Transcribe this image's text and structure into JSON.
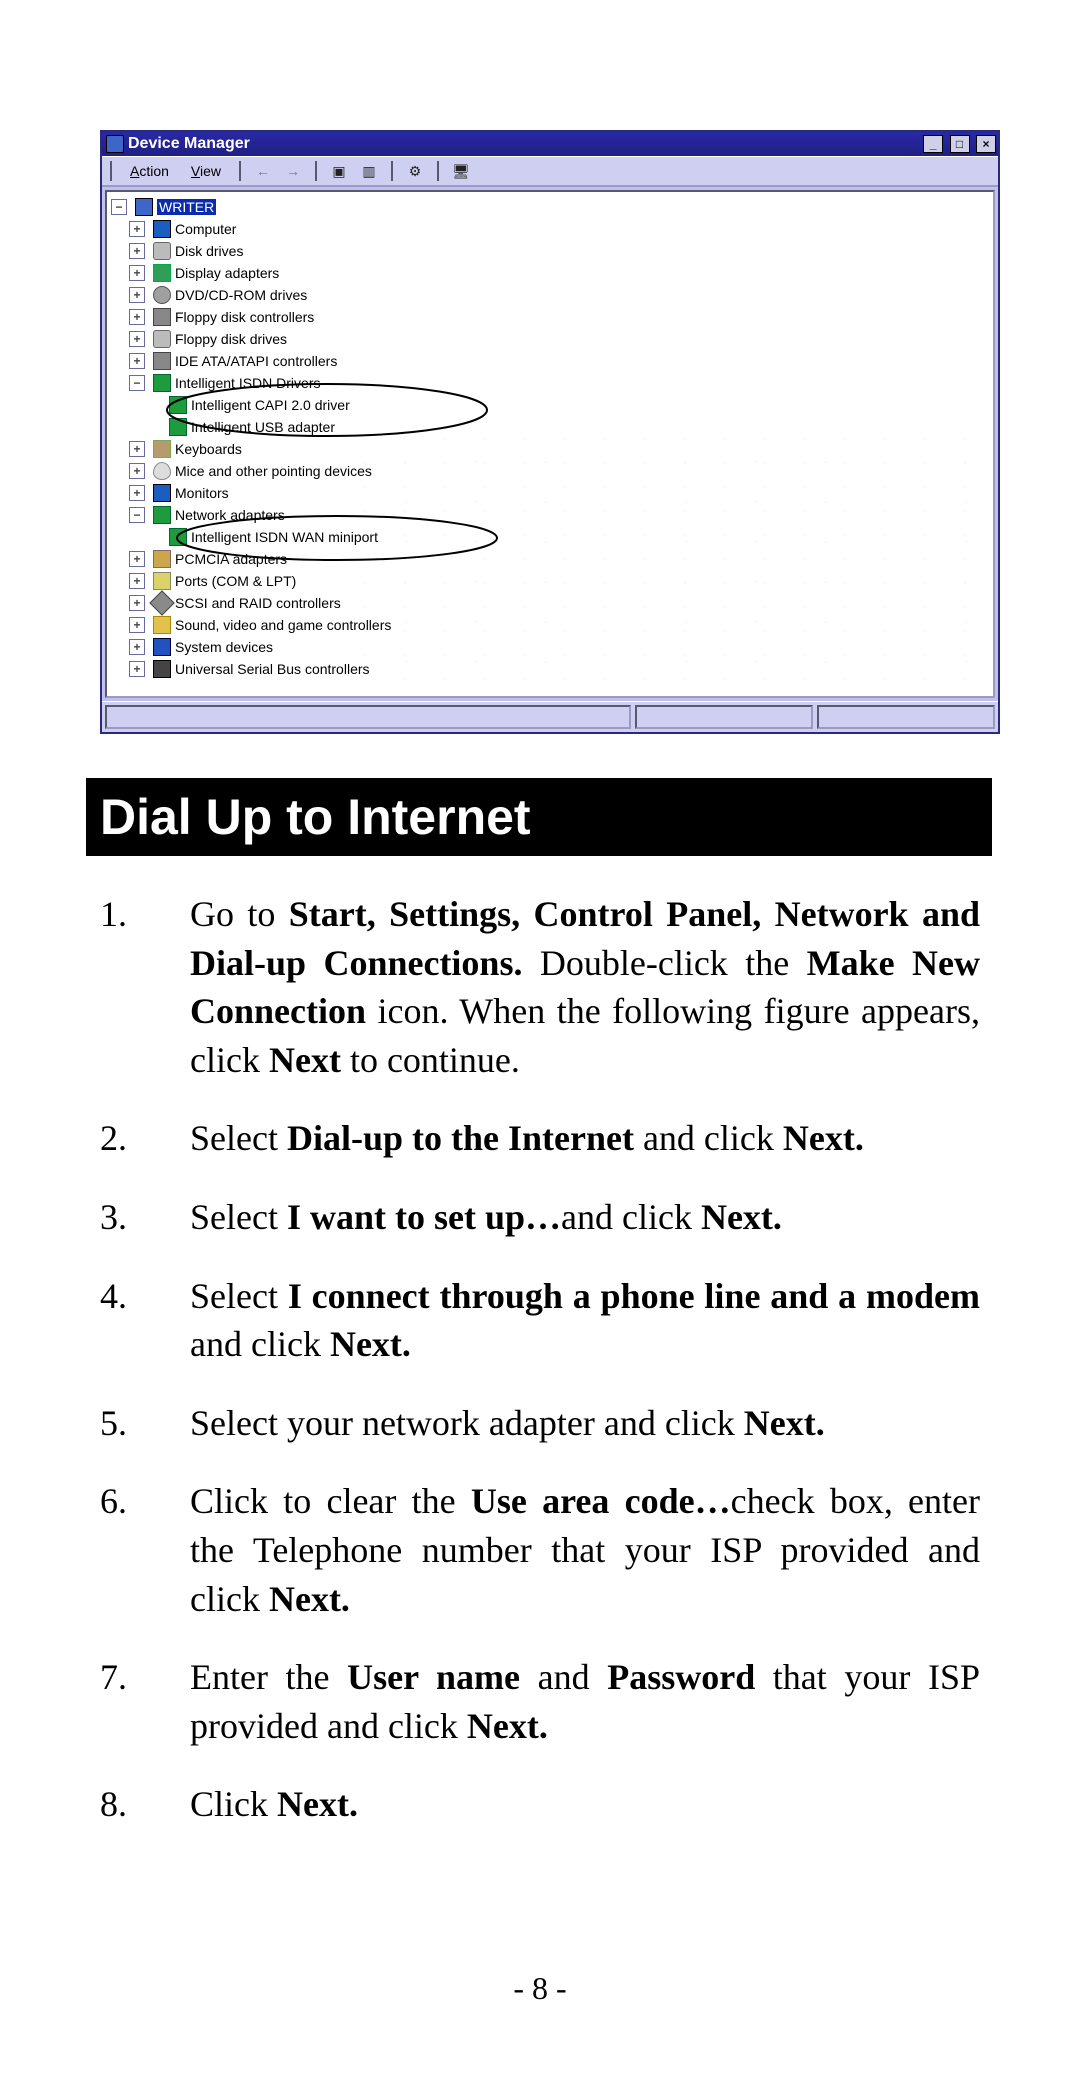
{
  "device_manager": {
    "title": "Device Manager",
    "menus": {
      "action": "Action",
      "view": "View"
    },
    "root": "WRITER",
    "nodes": {
      "computer": "Computer",
      "disk_drives": "Disk drives",
      "display": "Display adapters",
      "dvd": "DVD/CD-ROM drives",
      "floppy_ctrl": "Floppy disk controllers",
      "floppy_drv": "Floppy disk drives",
      "ide": "IDE ATA/ATAPI controllers",
      "isdn": "Intelligent ISDN Drivers",
      "isdn_capi": "Intelligent CAPI 2.0 driver",
      "isdn_usb": "Intelligent USB adapter",
      "keyboards": "Keyboards",
      "mice": "Mice and other pointing devices",
      "monitors": "Monitors",
      "net": "Network adapters",
      "net_isdn": "Intelligent ISDN WAN miniport",
      "pcmcia": "PCMCIA adapters",
      "ports": "Ports (COM & LPT)",
      "scsi": "SCSI and RAID controllers",
      "sound": "Sound, video and game controllers",
      "system": "System devices",
      "usb": "Universal Serial Bus controllers"
    }
  },
  "section_title": "Dial Up to Internet",
  "steps": {
    "s1a": "Go to ",
    "s1b": "Start, Settings, Control Panel, Network and Dial-up Connections.",
    "s1c": " Double-click the ",
    "s1d": "Make New Connection",
    "s1e": " icon. When the following figure appears, click ",
    "s1f": "Next",
    "s1g": " to continue.",
    "s2a": "Select ",
    "s2b": "Dial-up to the Internet",
    "s2c": " and click ",
    "s2d": "Next.",
    "s3a": "Select ",
    "s3b": "I want to set up…",
    "s3c": "and click ",
    "s3d": "Next.",
    "s4a": "Select ",
    "s4b": "I connect through a phone line and a modem",
    "s4c": " and click ",
    "s4d": "Next.",
    "s5a": "Select your network adapter and click ",
    "s5b": "Next.",
    "s6a": "Click to clear the ",
    "s6b": "Use area code…",
    "s6c": "check box, enter the Telephone number that your ISP provided and click ",
    "s6d": "Next.",
    "s7a": "Enter the ",
    "s7b": "User name",
    "s7c": " and ",
    "s7d": "Password",
    "s7e": " that your ISP provided and click ",
    "s7f": "Next.",
    "s8a": "Click ",
    "s8b": "Next."
  },
  "page_number": "- 8 -"
}
